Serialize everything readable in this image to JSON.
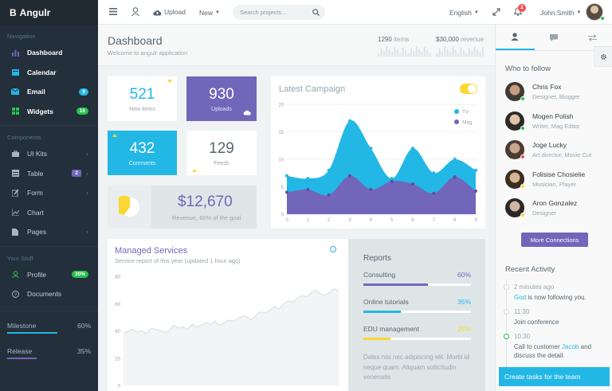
{
  "brand": {
    "name": "Angulr",
    "logo": "B"
  },
  "nav": {
    "section1": "Navigation",
    "items1": [
      {
        "label": "Dashboard",
        "icon": "bar-chart-icon",
        "color": "#7266ba"
      },
      {
        "label": "Calendar",
        "icon": "calendar-icon",
        "color": "#23b7e5"
      },
      {
        "label": "Email",
        "icon": "envelope-icon",
        "color": "#23b7e5",
        "badge": "9"
      },
      {
        "label": "Widgets",
        "icon": "grid-icon",
        "color": "#27c24c",
        "badge": "16"
      }
    ],
    "section2": "Components",
    "items2": [
      {
        "label": "UI Kits",
        "icon": "briefcase-icon"
      },
      {
        "label": "Table",
        "icon": "table-icon",
        "badge": "2"
      },
      {
        "label": "Form",
        "icon": "edit-icon"
      },
      {
        "label": "Chart",
        "icon": "line-chart-icon"
      },
      {
        "label": "Pages",
        "icon": "file-icon"
      }
    ],
    "section3": "Your Stuff",
    "items3": [
      {
        "label": "Profile",
        "icon": "user-icon",
        "badge": "30%"
      },
      {
        "label": "Documents",
        "icon": "question-icon"
      }
    ],
    "milestone": {
      "label": "Milestone",
      "value": "60%",
      "fraction": 0.6
    },
    "release": {
      "label": "Release",
      "value": "35%",
      "fraction": 0.35
    }
  },
  "header": {
    "upload": "Upload",
    "new": "New",
    "search_placeholder": "Search projects...",
    "language": "English",
    "notifications": "2",
    "user": "John.Smith"
  },
  "dashboard": {
    "title": "Dashboard",
    "subtitle": "Welcome to angulr application",
    "items_count": "1290",
    "items_label": "items",
    "revenue_amount": "$30,000",
    "revenue_label": "revenue",
    "stats": [
      {
        "value": "521",
        "label": "New items"
      },
      {
        "value": "930",
        "label": "Uploads"
      },
      {
        "value": "432",
        "label": "Comments"
      },
      {
        "value": "129",
        "label": "Feeds"
      }
    ],
    "revenue_value": "$12,670",
    "revenue_desc": "Revenue, 60% of the goal",
    "revenue_fraction": 0.6
  },
  "campaign": {
    "title": "Latest Campaign",
    "legend": [
      "TV",
      "Mag"
    ]
  },
  "chart_data": [
    {
      "type": "area",
      "title": "Latest Campaign",
      "x": [
        0,
        1,
        2,
        3,
        4,
        5,
        6,
        7,
        8,
        9
      ],
      "ylim": [
        0,
        20
      ],
      "yticks": [
        0,
        5,
        10,
        15,
        20
      ],
      "series": [
        {
          "name": "TV",
          "color": "#23b7e5",
          "values": [
            7,
            6.5,
            8,
            17,
            12,
            6.5,
            12,
            7.5,
            10,
            8
          ]
        },
        {
          "name": "Mag",
          "color": "#7266ba",
          "values": [
            4,
            4.5,
            3.5,
            7,
            4.5,
            6,
            5.5,
            3.8,
            6.8,
            4.2
          ]
        }
      ]
    },
    {
      "type": "area",
      "title": "Managed Services",
      "ylim": [
        0,
        80
      ],
      "yticks": [
        0,
        20,
        40,
        60,
        80
      ],
      "series": [
        {
          "name": "",
          "color": "#dde3e6",
          "values": [
            38,
            40,
            41,
            39,
            40,
            38,
            42,
            41,
            40,
            39,
            40,
            44,
            42,
            43,
            41,
            45,
            43,
            44,
            46,
            45,
            47,
            44,
            46,
            48,
            47,
            49,
            51,
            50,
            48,
            52,
            54,
            53,
            55,
            58,
            56,
            60,
            62,
            61,
            64,
            66,
            65,
            68,
            70,
            67,
            66,
            68,
            71,
            69
          ]
        }
      ]
    }
  ],
  "managed": {
    "title": "Managed Services",
    "subtitle": "Service report of this year (updated 1 hour ago)"
  },
  "reports": {
    "title": "Reports",
    "items": [
      {
        "label": "Consulting",
        "value": "60%",
        "fraction": 0.6,
        "color": "#7266ba"
      },
      {
        "label": "Online tutorials",
        "value": "35%",
        "fraction": 0.35,
        "color": "#23b7e5"
      },
      {
        "label": "EDU management",
        "value": "25%",
        "fraction": 0.25,
        "color": "#fad733"
      }
    ],
    "text": "Dales nisi nec adipiscing elit. Morbi id neque quam. Aliquam sollicitudin venenatis"
  },
  "right": {
    "who_title": "Who to follow",
    "people": [
      {
        "name": "Chris Fox",
        "role": "Designer, Blogger",
        "status": "#27c24c"
      },
      {
        "name": "Mogen Polish",
        "role": "Writer, Mag Editor",
        "status": "#27c24c"
      },
      {
        "name": "Joge Lucky",
        "role": "Art director, Movie Cut",
        "status": "#f05050"
      },
      {
        "name": "Folisise Chosielie",
        "role": "Musician, Player",
        "status": "#fad733"
      },
      {
        "name": "Aron Gonzalez",
        "role": "Designer",
        "status": "#fad733"
      }
    ],
    "more_button": "More Connections",
    "activity_title": "Recent Activity",
    "activity": [
      {
        "time": "2 minutes ago",
        "link": "God",
        "text": " is now following you."
      },
      {
        "time": "11:30",
        "text": "Join conference"
      },
      {
        "time": "10:30",
        "pre": "Call to customer ",
        "link": "Jacob",
        "post": " and discuss the detail."
      }
    ],
    "create_button": "Create tasks for the team"
  }
}
